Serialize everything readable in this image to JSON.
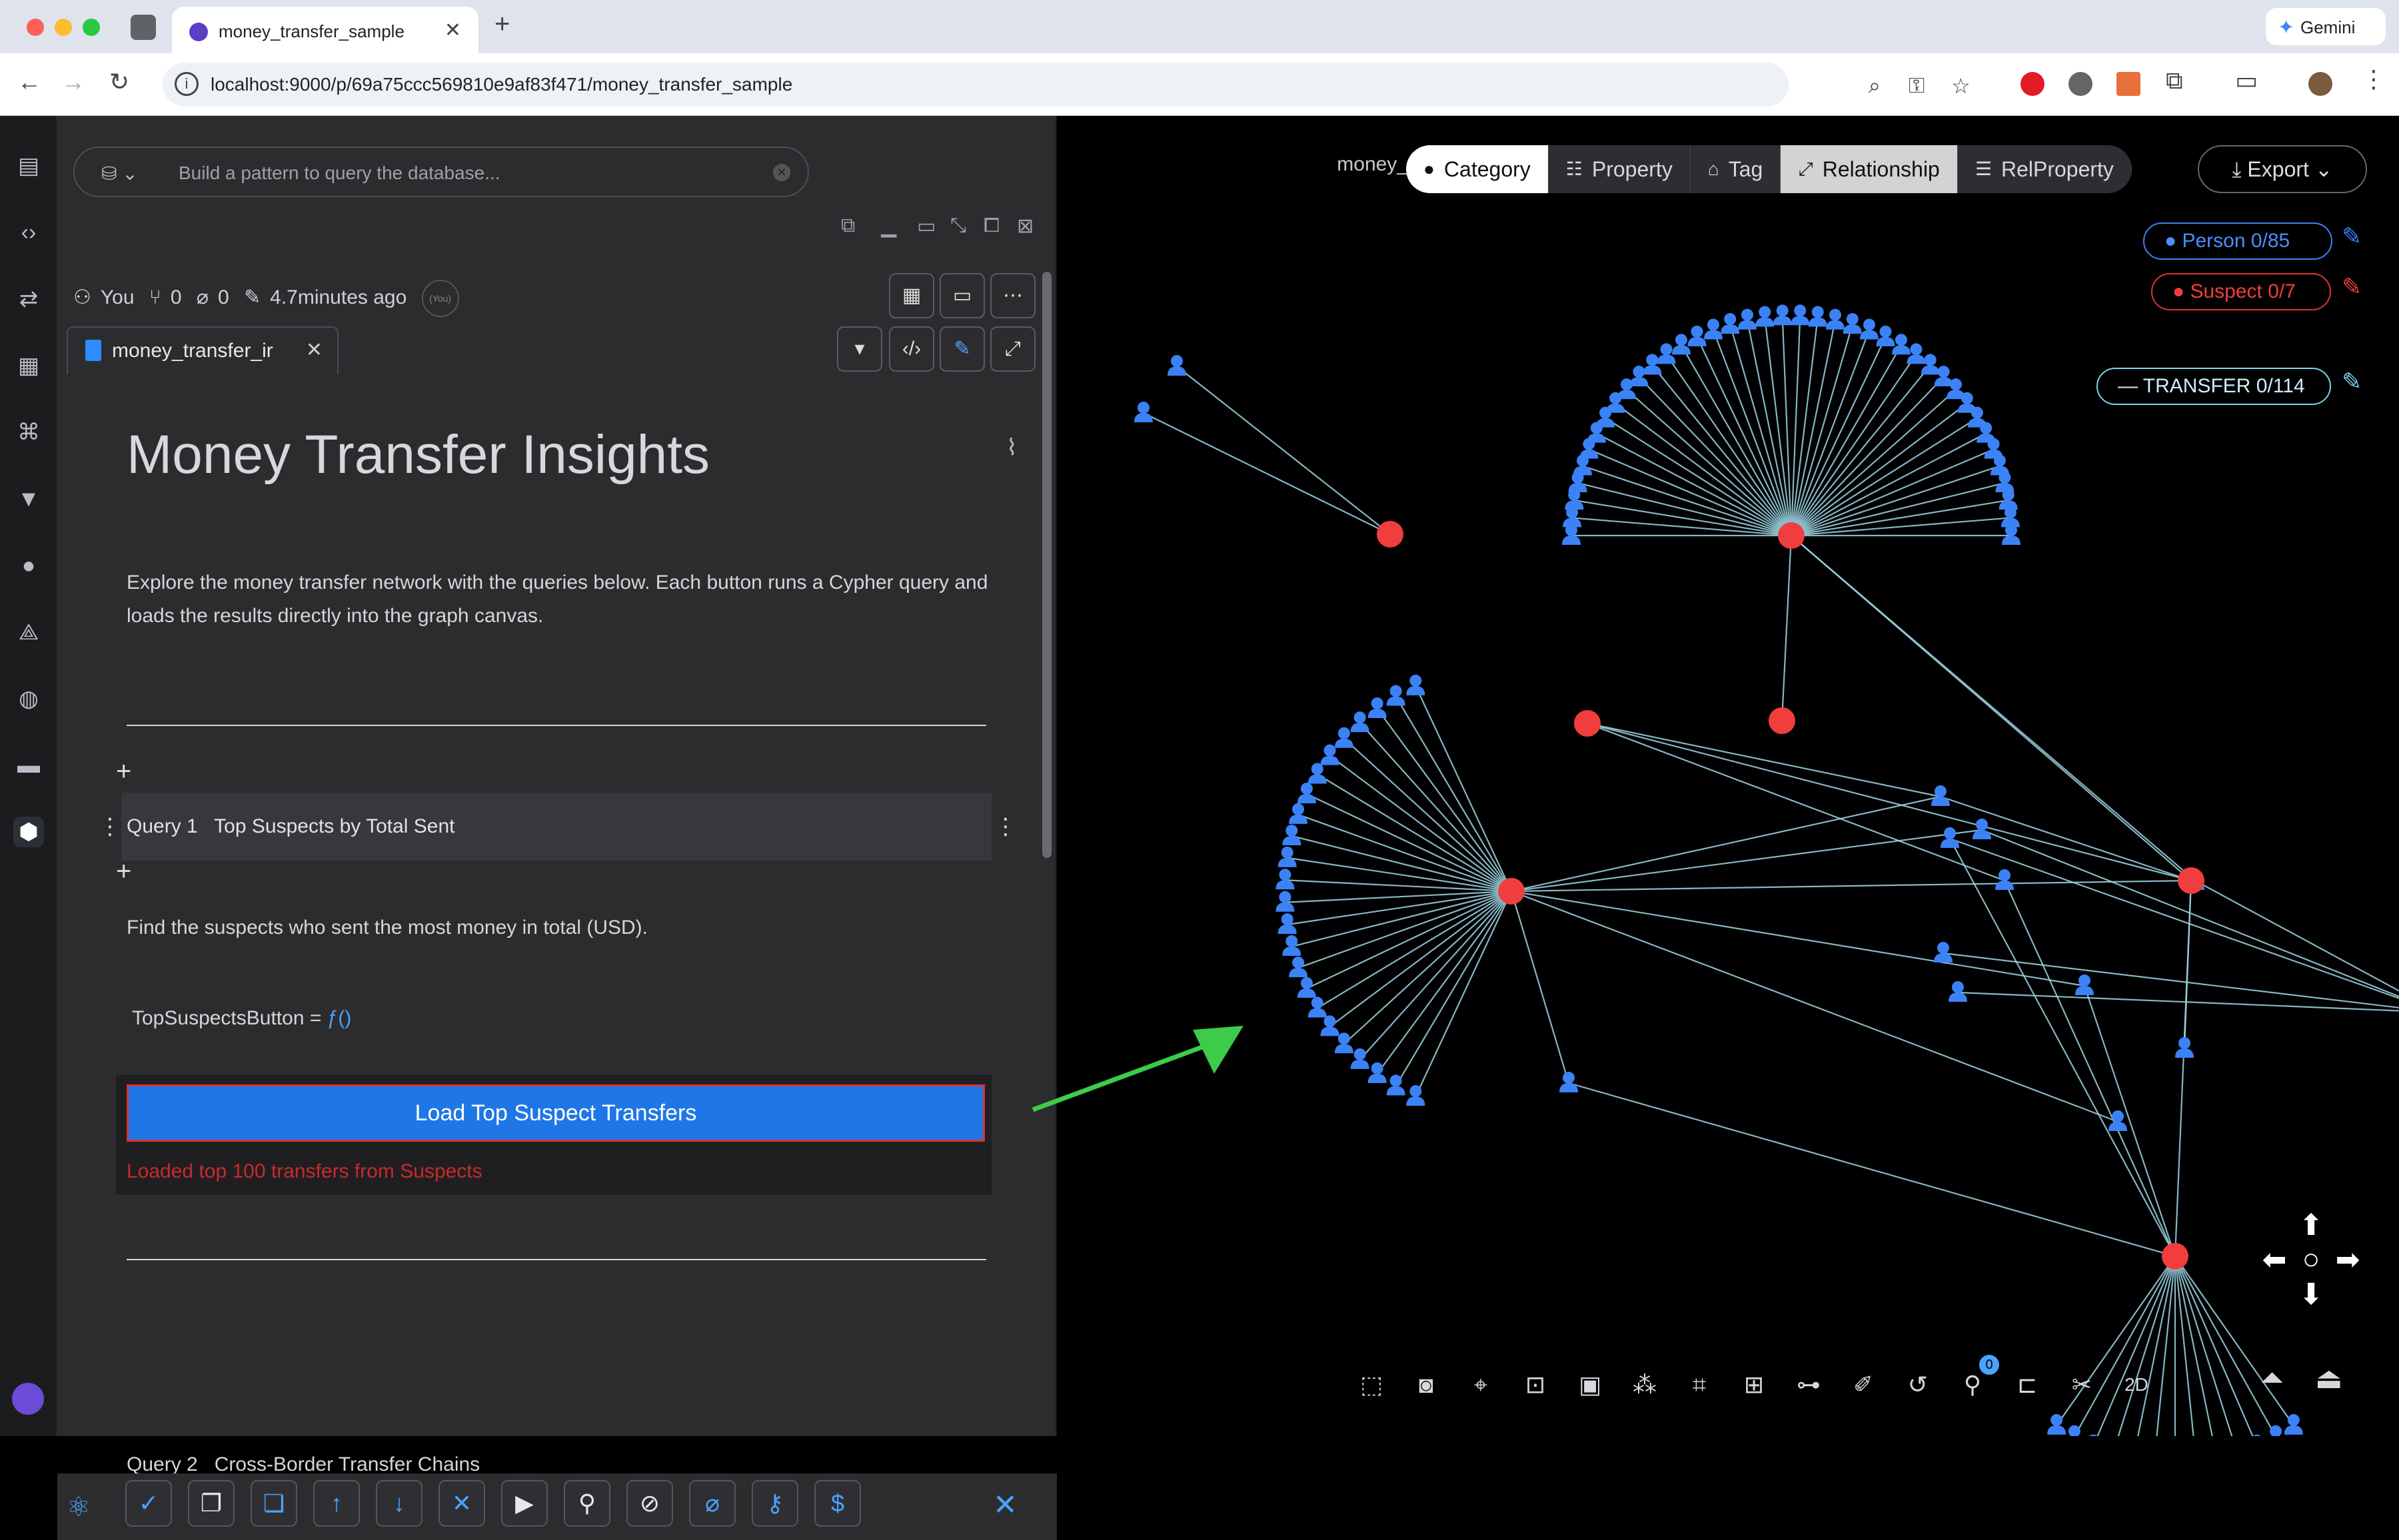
{
  "browser": {
    "tab_title": "money_transfer_sample",
    "url": "localhost:9000/p/69a75ccc569810e9af83f471/money_transfer_sample",
    "gemini_label": "Gemini"
  },
  "notebook": {
    "query_placeholder": "Build a pattern to query the database...",
    "meta": {
      "user": "You",
      "branches": "0",
      "attachments": "0",
      "edited": "4.7minutes ago",
      "badge": "(You)"
    },
    "file_tab": "money_transfer_ir",
    "title": "Money Transfer Insights",
    "intro": "Explore the money transfer network with the queries below. Each button runs a Cypher query and loads the results directly into the graph canvas.",
    "query1_label": "Query 1   Top Suspects by Total Sent",
    "query1_desc": "Find the suspects who sent the most money in total (USD).",
    "code_name": "TopSuspectsButton = ",
    "code_fn": "ƒ()",
    "button_label": "Load Top Suspect Transfers",
    "status": "Loaded top 100 transfers from Suspects",
    "query2_label": "Query 2   Cross-Border Transfer Chains"
  },
  "canvas": {
    "view_name": "money_transfer_sample / Unsaved View*",
    "segments": [
      {
        "label": "Category",
        "icon": "circle-icon"
      },
      {
        "label": "Property",
        "icon": "list-icon"
      },
      {
        "label": "Tag",
        "icon": "tag-icon"
      },
      {
        "label": "Relationship",
        "icon": "edge-icon"
      },
      {
        "label": "RelProperty",
        "icon": "list-icon"
      }
    ],
    "export_label": "Export",
    "legend": {
      "person": "Person 0/85",
      "suspect": "Suspect 0/7",
      "transfer": "TRANSFER 0/114"
    },
    "pin_badge": "0",
    "mode_label": "2D"
  },
  "colors": {
    "accent": "#1f77e6",
    "person_node": "#3b82f6",
    "suspect_node": "#f03e3e",
    "edge": "#9fd6e6",
    "arrow": "#3dcc4a"
  }
}
